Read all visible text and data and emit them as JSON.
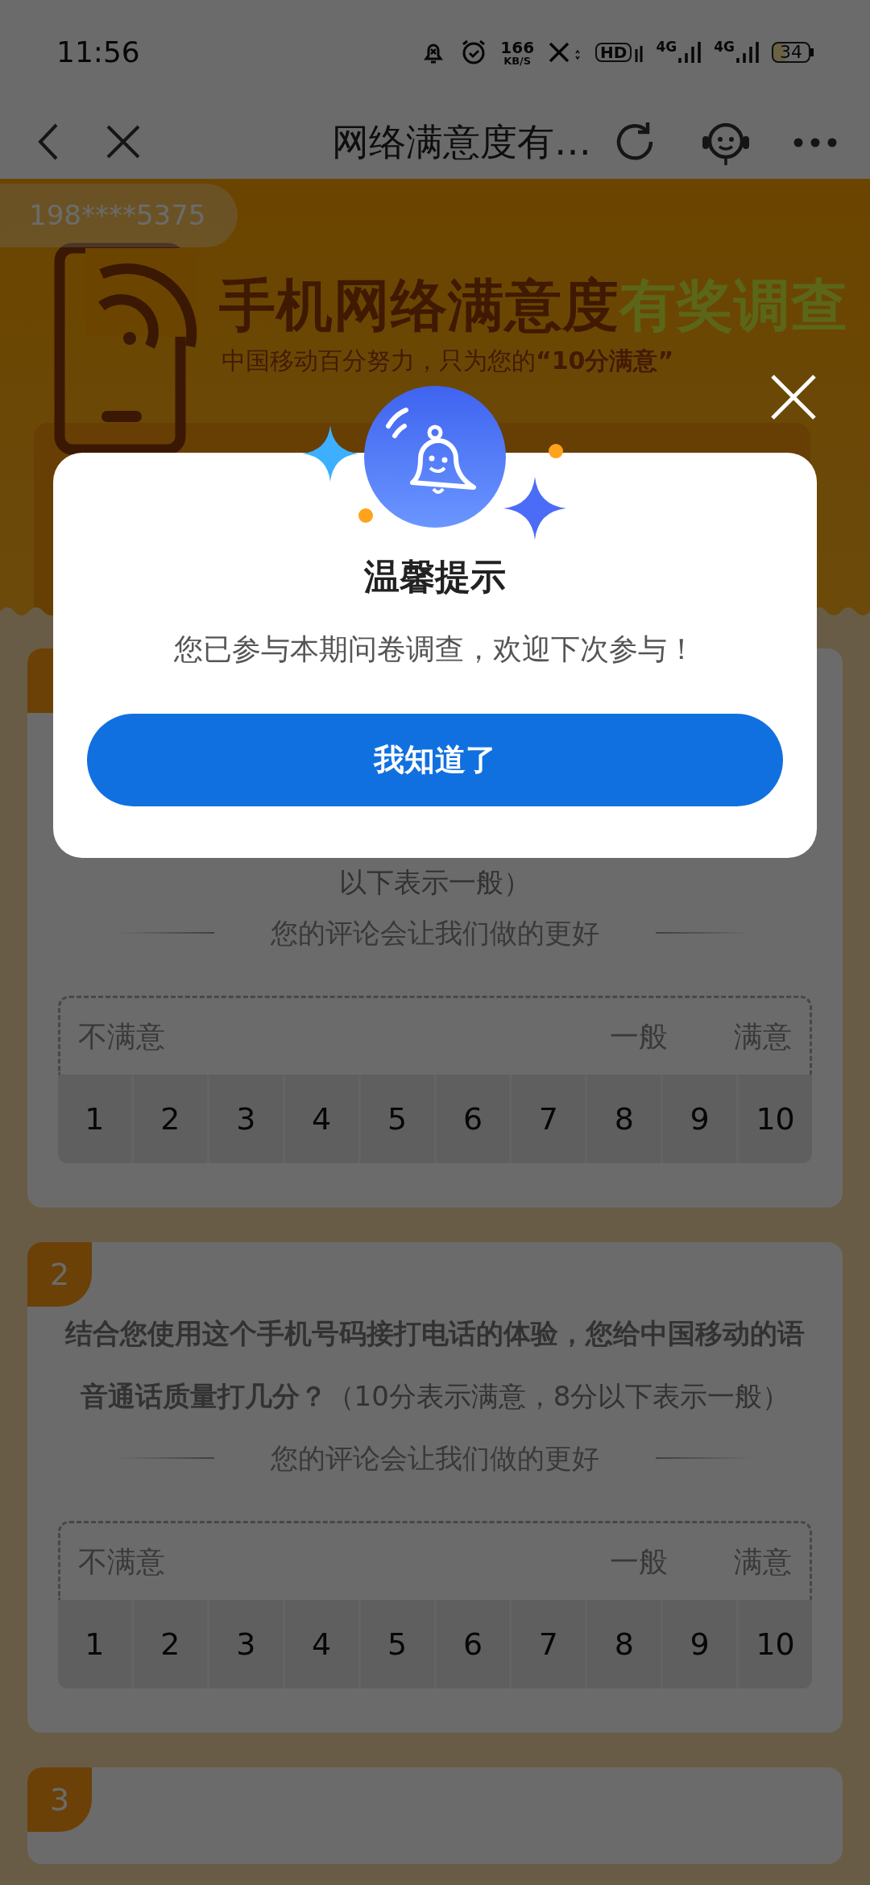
{
  "status_bar": {
    "time": "11:56",
    "speed_value": "166",
    "speed_unit": "KB/S",
    "hd_label": "HD",
    "networks": [
      "4G",
      "4G"
    ],
    "battery": "34"
  },
  "header": {
    "title": "网络满意度有…"
  },
  "banner": {
    "phone": "198****5375",
    "title_main": "手机网络满意度",
    "title_accent": "有奖调查",
    "subtitle": "中国移动百分努力，只为您的**“10分满意”**"
  },
  "questions": [
    {
      "text": "以下表示一般）",
      "comment": "您的评论会让我们做的更好",
      "scale": {
        "low": "不满意",
        "mid": "一般",
        "high": "满意",
        "options": [
          "1",
          "2",
          "3",
          "4",
          "5",
          "6",
          "7",
          "8",
          "9",
          "10"
        ]
      }
    },
    {
      "number": "2",
      "text": "**结合您使用这个手机号码接打电话的体验，您给中国移动的语音通话质量打几分？**（10分表示满意，8分以下表示一般）",
      "comment": "您的评论会让我们做的更好",
      "scale": {
        "low": "不满意",
        "mid": "一般",
        "high": "满意",
        "options": [
          "1",
          "2",
          "3",
          "4",
          "5",
          "6",
          "7",
          "8",
          "9",
          "10"
        ]
      }
    },
    {
      "number": "3"
    }
  ],
  "dialog": {
    "title": "温馨提示",
    "message": "您已参与本期问卷调查，欢迎下次参与！",
    "button": "我知道了"
  }
}
